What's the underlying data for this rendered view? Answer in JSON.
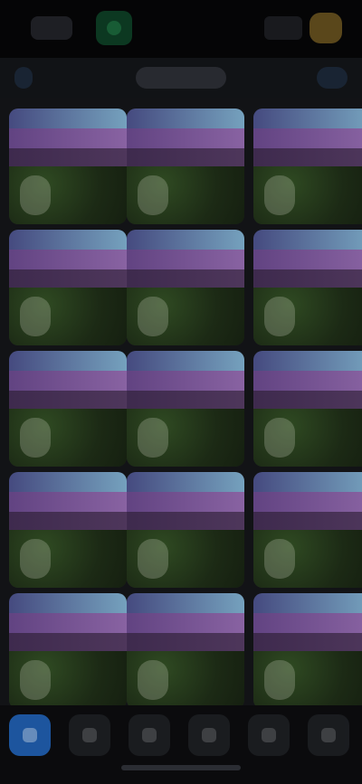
{
  "header": {
    "back_label": "",
    "title": "",
    "action_label": ""
  },
  "icons": {
    "status_left": "status-left-icon",
    "status_recording": "recording-indicator-icon",
    "status_right": "status-right-icon",
    "battery": "battery-icon",
    "back": "chevron-left-icon",
    "more": "more-icon",
    "tab_1": "tab-icon-1",
    "tab_2": "tab-icon-2",
    "tab_3": "tab-icon-3",
    "tab_4": "tab-icon-4",
    "tab_5": "tab-icon-5",
    "tab_6": "tab-icon-6"
  },
  "colors": {
    "background": "#0f1012",
    "recording": "#1f7a45",
    "battery": "#6a5320",
    "tab_active": "#1e5aa6"
  },
  "grid": {
    "rows": 5,
    "cols": 3,
    "items": [
      {
        "label": ""
      },
      {
        "label": ""
      },
      {
        "label": ""
      },
      {
        "label": ""
      },
      {
        "label": ""
      },
      {
        "label": ""
      },
      {
        "label": ""
      },
      {
        "label": ""
      },
      {
        "label": ""
      },
      {
        "label": ""
      },
      {
        "label": ""
      },
      {
        "label": ""
      },
      {
        "label": ""
      },
      {
        "label": ""
      },
      {
        "label": ""
      }
    ]
  },
  "tabs": [
    {
      "label": ""
    },
    {
      "label": ""
    },
    {
      "label": ""
    },
    {
      "label": ""
    },
    {
      "label": ""
    },
    {
      "label": ""
    }
  ]
}
